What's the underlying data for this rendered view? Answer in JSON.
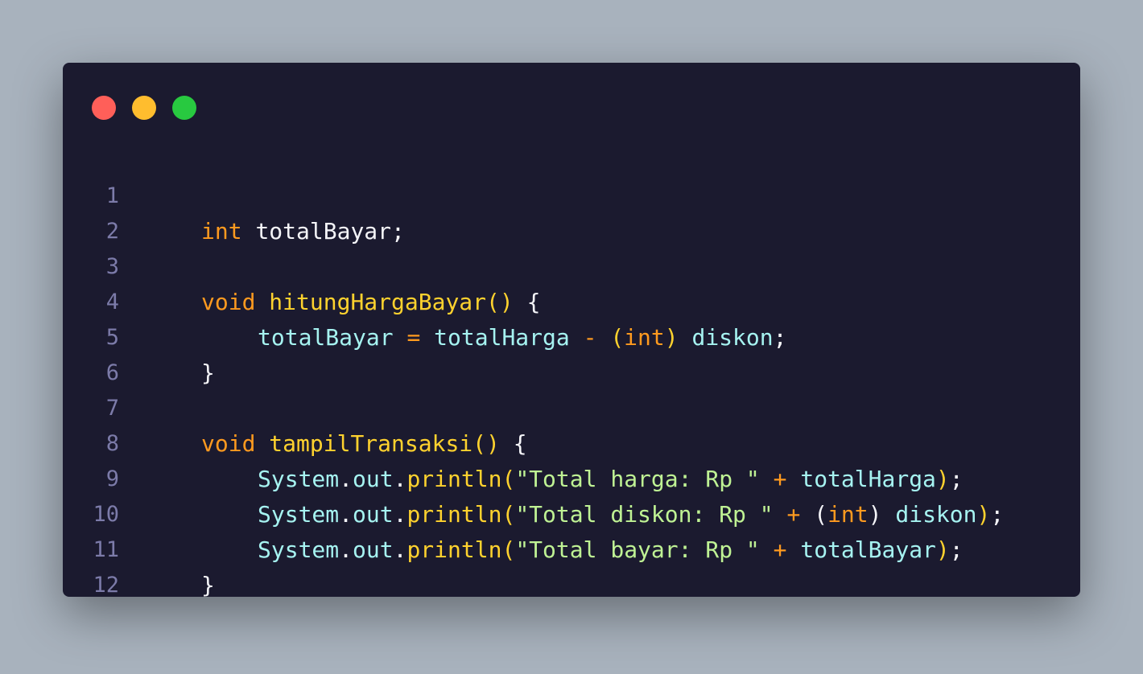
{
  "window": {
    "controls": [
      {
        "name": "close",
        "color": "#ff5f59"
      },
      {
        "name": "minimize",
        "color": "#ffbd2e"
      },
      {
        "name": "maximize",
        "color": "#28c940"
      }
    ]
  },
  "colors": {
    "background": "#a8b2bd",
    "editor": "#1b1a2f",
    "line_number": "#7c7ba9",
    "keyword": "#ff9a1f",
    "function": "#ffd22e",
    "variable": "#a6f3f1",
    "string": "#bff294",
    "plain": "#f4f4f8"
  },
  "code": {
    "lines": [
      {
        "num": "1",
        "t": [
          "int",
          " ",
          "totalBayar",
          ";"
        ]
      },
      {
        "num": "2",
        "t": []
      },
      {
        "num": "3",
        "t": [
          "void",
          " ",
          "hitungHargaBayar",
          "()",
          " {"
        ]
      },
      {
        "num": "4",
        "t": [
          "totalBayar",
          " ",
          "=",
          " ",
          "totalHarga",
          " ",
          "-",
          " ",
          "(",
          "int",
          ")",
          " ",
          "diskon",
          ";"
        ]
      },
      {
        "num": "5",
        "t": [
          "}"
        ]
      },
      {
        "num": "6",
        "t": []
      },
      {
        "num": "7",
        "t": [
          "void",
          " ",
          "tampilTransaksi",
          "()",
          " {"
        ]
      },
      {
        "num": "8",
        "t": [
          "System",
          ".",
          "out",
          ".",
          "println",
          "(",
          "\"Total harga: Rp \"",
          " ",
          "+",
          " ",
          "totalHarga",
          ")",
          ";"
        ]
      },
      {
        "num": "9",
        "t": [
          "System",
          ".",
          "out",
          ".",
          "println",
          "(",
          "\"Total diskon: Rp \"",
          " ",
          "+",
          " ",
          "(",
          "int",
          ")",
          " ",
          "diskon",
          ")",
          ";"
        ]
      },
      {
        "num": "10",
        "t": [
          "System",
          ".",
          "out",
          ".",
          "println",
          "(",
          "\"Total bayar: Rp \"",
          " ",
          "+",
          " ",
          "totalBayar",
          ")",
          ";"
        ]
      },
      {
        "num": "11",
        "t": [
          "}"
        ]
      },
      {
        "num": "12",
        "t": []
      }
    ]
  }
}
